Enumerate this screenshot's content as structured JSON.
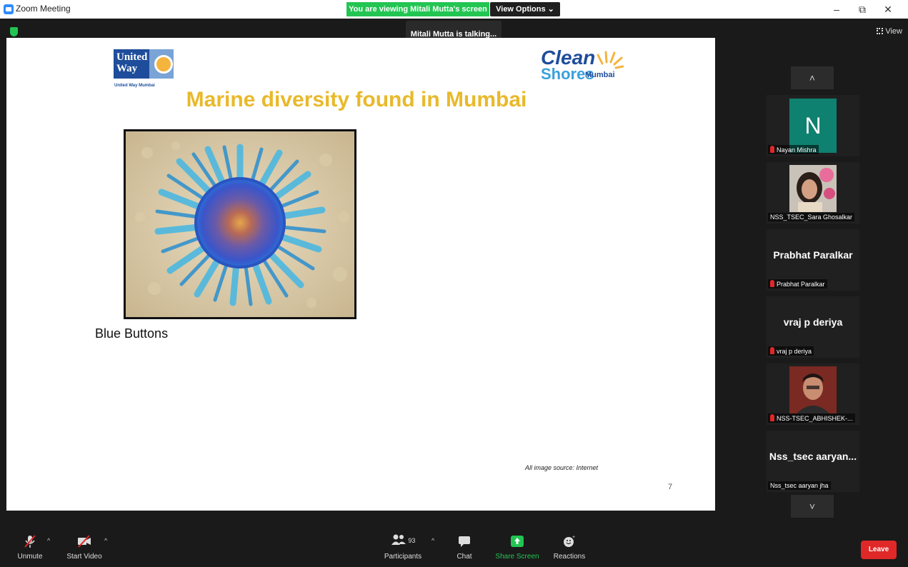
{
  "window": {
    "title": "Zoom Meeting",
    "viewing_banner": "You are viewing Mitali Mutta's screen",
    "view_options": "View Options ⌄",
    "minimize": "–",
    "restore": "⧉",
    "close": "✕"
  },
  "meeting": {
    "talking": "Mitali Mutta is talking...",
    "view_label": "View"
  },
  "slide": {
    "uw_logo_text": "United Way",
    "uw_caption": "United Way Mumbai",
    "cs_clean": "Clean",
    "cs_shores": "Shores",
    "cs_mumbai": "Mumbai",
    "title": "Marine diversity found in Mumbai",
    "photo_caption": "Blue Buttons",
    "source": "All image source: Internet",
    "page_number": "7"
  },
  "panel": {
    "scroll_up": "˄",
    "scroll_down": "˅",
    "participants": [
      {
        "initial": "N",
        "name": "Nayan Mishra",
        "muted": true
      },
      {
        "name": "NSS_TSEC_Sara Ghosalkar",
        "muted": false
      },
      {
        "display_name": "Prabhat Paralkar",
        "name": "Prabhat Paralkar",
        "muted": true
      },
      {
        "display_name": "vraj p deriya",
        "name": "vraj p deriya",
        "muted": true
      },
      {
        "name": "NSS-TSEC_ABHISHEK-...",
        "muted": true
      },
      {
        "display_name": "Nss_tsec  aaryan...",
        "name": "Nss_tsec aaryan jha",
        "muted": false
      }
    ]
  },
  "toolbar": {
    "unmute": "Unmute",
    "start_video": "Start Video",
    "participants": "Participants",
    "participant_count": "93",
    "chat": "Chat",
    "share_screen": "Share Screen",
    "reactions": "Reactions",
    "leave": "Leave",
    "caret": "^"
  },
  "colors": {
    "share_green": "#23c552",
    "leave_red": "#e02828",
    "title_gold": "#e9b92b"
  }
}
